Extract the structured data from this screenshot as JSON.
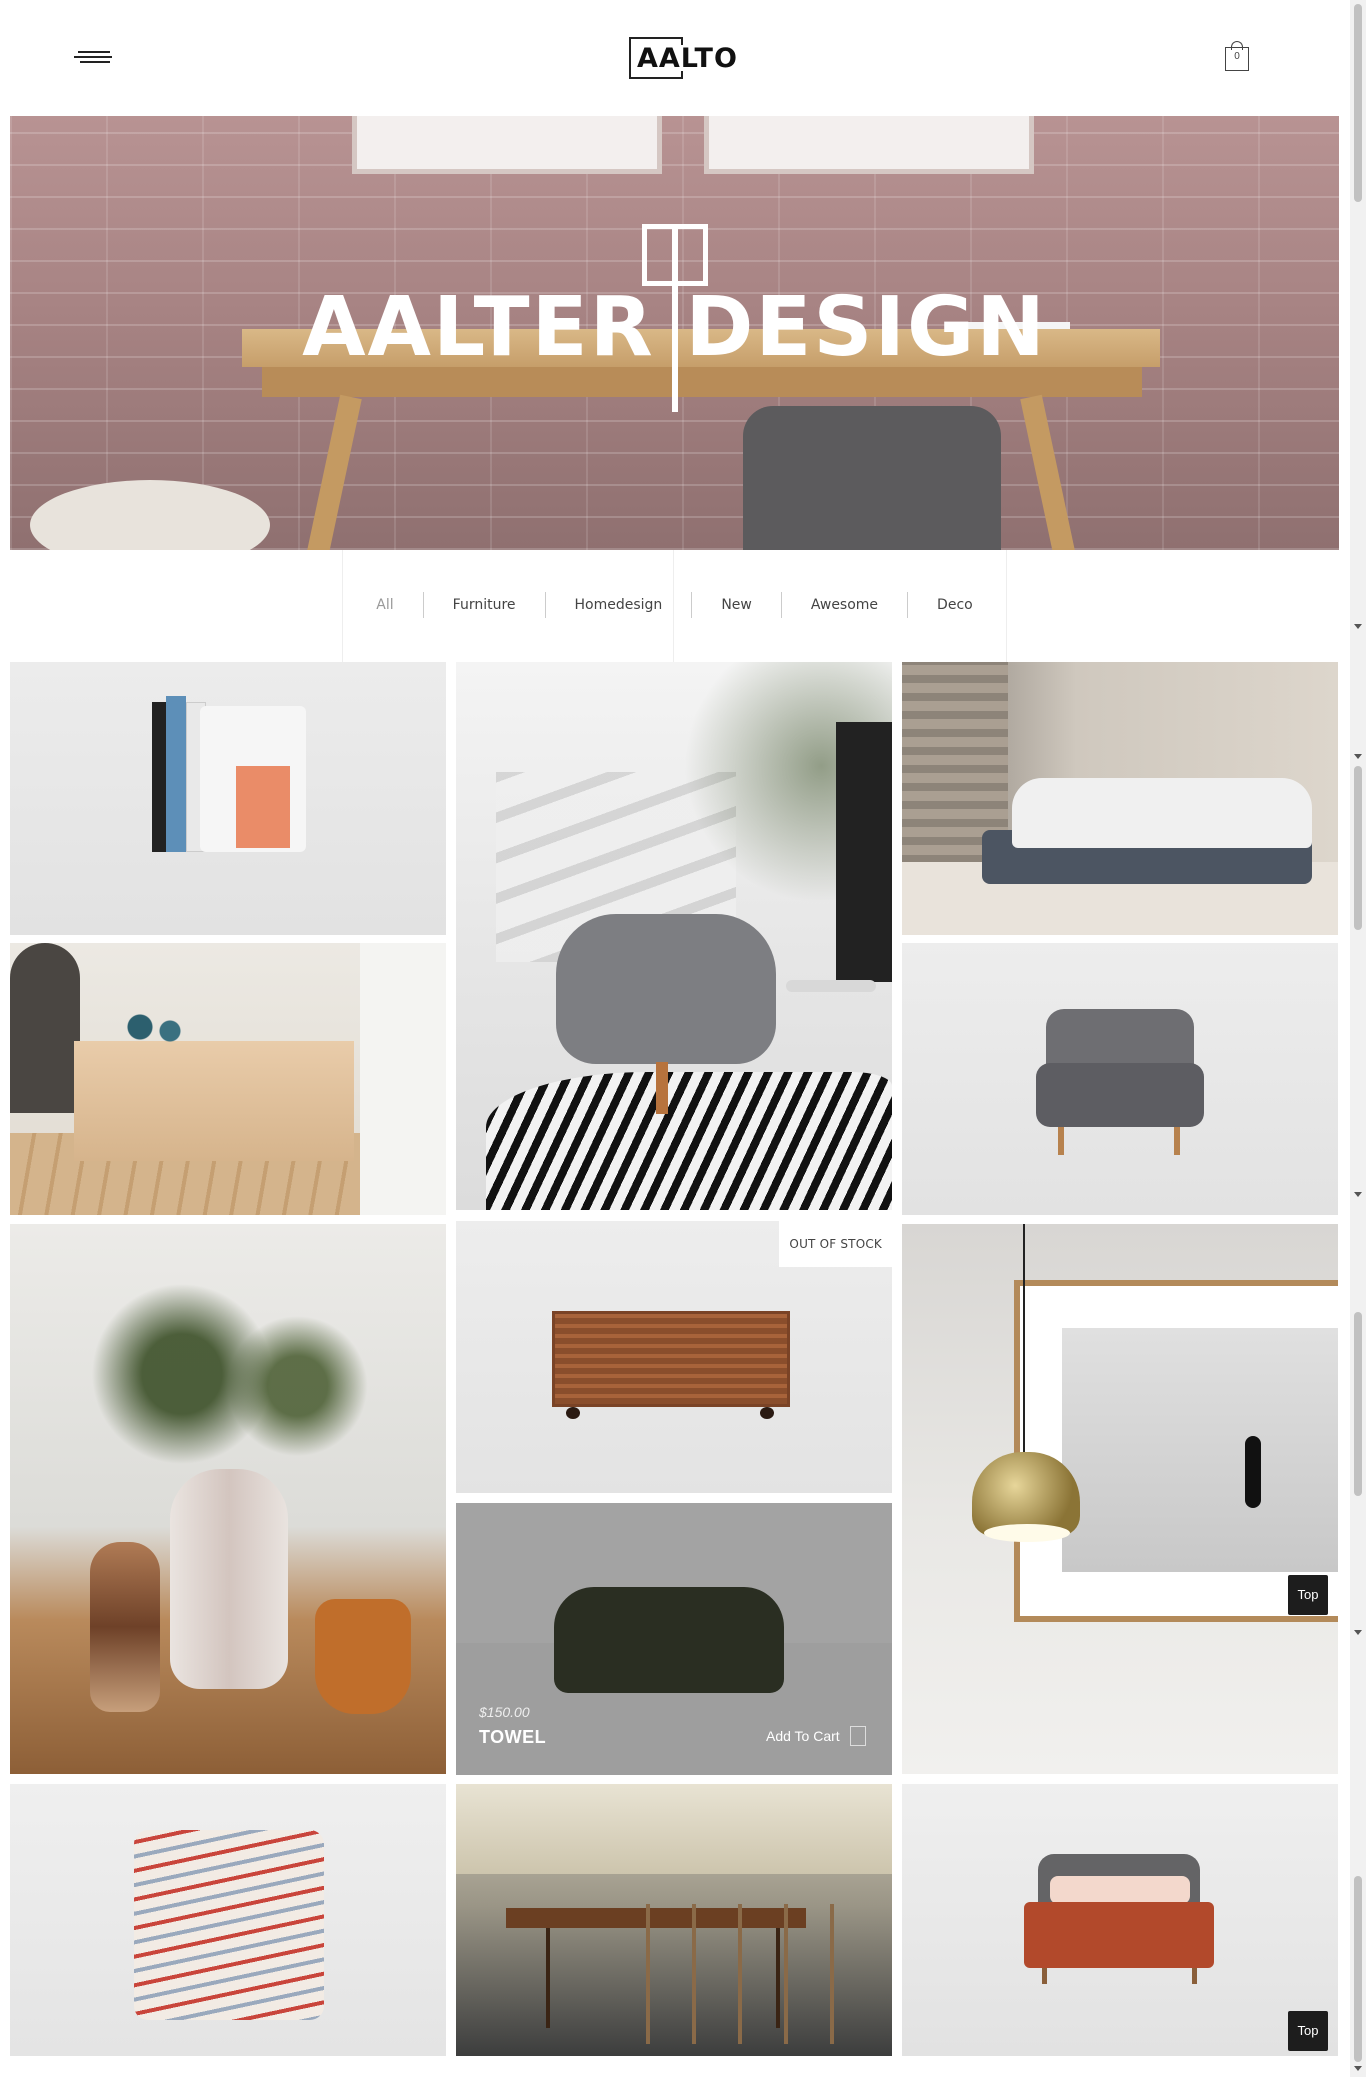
{
  "header": {
    "logo_text": "AALTO",
    "cart_count": "0",
    "menu_icon": "hamburger-icon",
    "cart_icon": "shopping-bag-icon"
  },
  "hero": {
    "title": "AALTER DESIGN"
  },
  "filters": {
    "items": [
      "All",
      "Furniture",
      "Homedesign",
      "New",
      "Awesome",
      "Deco"
    ]
  },
  "products": {
    "slat_cabinet": {
      "badge": "OUT OF STOCK"
    },
    "towel": {
      "price": "$150.00",
      "name": "TOWEL",
      "add_to_cart": "Add To Cart"
    }
  },
  "buttons": {
    "top_label": "Top"
  },
  "colors": {
    "accent": "#1d1d1d",
    "background": "#ffffff"
  }
}
